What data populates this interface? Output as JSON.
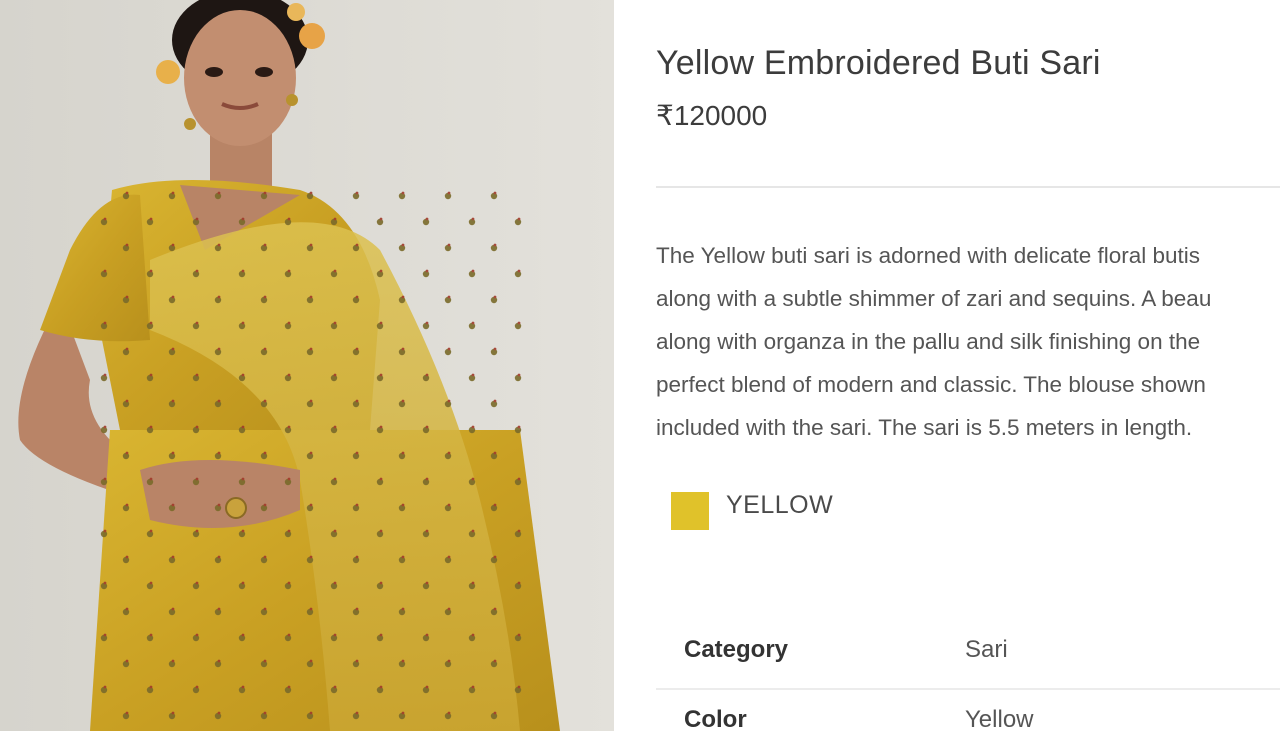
{
  "product": {
    "title": "Yellow Embroidered Buti Sari",
    "price": "₹120000",
    "description_lines": [
      "The Yellow buti sari is adorned with delicate floral butis",
      "along with a subtle shimmer of zari and sequins. A beau",
      "along with organza in the pallu and silk finishing on the",
      "perfect blend of modern and classic. The blouse shown",
      "included with the sari. The sari is 5.5 meters in length."
    ],
    "color": {
      "name": "YELLOW",
      "swatch_hex": "#e0c22a"
    },
    "specs": [
      {
        "label": "Category",
        "value": "Sari"
      },
      {
        "label": "Color",
        "value": "Yellow"
      }
    ]
  },
  "image": {
    "alt_subject": "model-wearing-yellow-sari",
    "sari_color": "#d7b22c",
    "background_color": "#dcd9d2"
  }
}
